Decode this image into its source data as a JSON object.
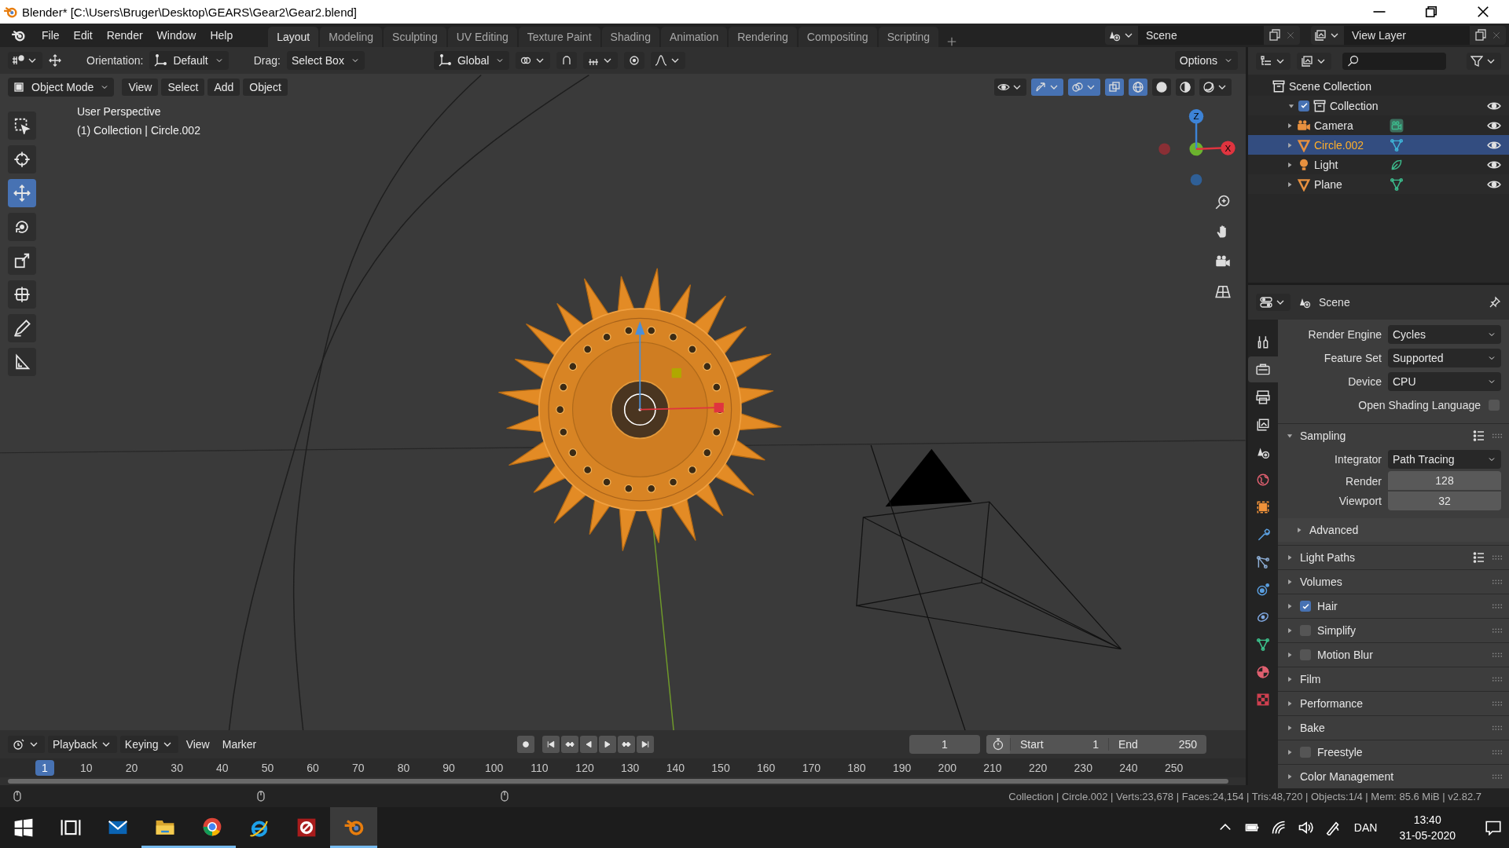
{
  "window": {
    "title": "Blender* [C:\\Users\\Bruger\\Desktop\\GEARS\\Gear2\\Gear2.blend]"
  },
  "menu": [
    "File",
    "Edit",
    "Render",
    "Window",
    "Help"
  ],
  "workspaces": [
    {
      "label": "Layout",
      "selected": true
    },
    {
      "label": "Modeling",
      "selected": false
    },
    {
      "label": "Sculpting",
      "selected": false
    },
    {
      "label": "UV Editing",
      "selected": false
    },
    {
      "label": "Texture Paint",
      "selected": false
    },
    {
      "label": "Shading",
      "selected": false
    },
    {
      "label": "Animation",
      "selected": false
    },
    {
      "label": "Rendering",
      "selected": false
    },
    {
      "label": "Compositing",
      "selected": false
    },
    {
      "label": "Scripting",
      "selected": false
    }
  ],
  "scene": "Scene",
  "view_layer": "View Layer",
  "tool_settings": {
    "orientation_label": "Orientation:",
    "orientation": "Default",
    "drag_label": "Drag:",
    "drag": "Select Box",
    "transform_orientation": "Global",
    "options": "Options"
  },
  "viewport_header": {
    "mode": "Object Mode",
    "menus": [
      "View",
      "Select",
      "Add",
      "Object"
    ]
  },
  "tools": [
    {
      "kind": "select_box",
      "selected": false
    },
    {
      "kind": "cursor",
      "selected": false
    },
    {
      "kind": "move",
      "selected": true
    },
    {
      "kind": "rotate",
      "selected": false
    },
    {
      "kind": "scale",
      "selected": false
    },
    {
      "kind": "transform",
      "selected": false
    },
    {
      "kind": "annotate",
      "selected": false
    },
    {
      "kind": "measure",
      "selected": false
    }
  ],
  "viewport_info": [
    "User Perspective",
    "(1) Collection | Circle.002"
  ],
  "navigation_gizmo": {
    "z": "Z",
    "x": "X"
  },
  "outliner": {
    "root": "Scene Collection",
    "items": [
      {
        "label": "Collection",
        "kind": "collection",
        "expanded": true,
        "checked": true,
        "selected": false,
        "children": [
          {
            "label": "Camera",
            "kind": "camera",
            "expanded": false,
            "selected": false
          },
          {
            "label": "Circle.002",
            "kind": "mesh",
            "expanded": false,
            "selected": true
          },
          {
            "label": "Light",
            "kind": "light",
            "expanded": false,
            "selected": false
          },
          {
            "label": "Plane",
            "kind": "mesh",
            "expanded": false,
            "selected": false
          }
        ]
      }
    ]
  },
  "properties": {
    "context": "Scene",
    "tabs": [
      {
        "kind": "tool",
        "selected": false
      },
      {
        "kind": "render",
        "selected": true
      },
      {
        "kind": "output",
        "selected": false
      },
      {
        "kind": "view_layer",
        "selected": false
      },
      {
        "kind": "scene",
        "selected": false
      },
      {
        "kind": "world",
        "selected": false
      },
      {
        "kind": "object",
        "selected": false
      },
      {
        "kind": "modifiers",
        "selected": false
      },
      {
        "kind": "particles",
        "selected": false
      },
      {
        "kind": "physics",
        "selected": false
      },
      {
        "kind": "constraints",
        "selected": false
      },
      {
        "kind": "data",
        "selected": false
      },
      {
        "kind": "material",
        "selected": false
      },
      {
        "kind": "texture",
        "selected": false
      }
    ],
    "fields": [
      {
        "label": "Render Engine",
        "kind": "dropdown",
        "value": "Cycles"
      },
      {
        "label": "Feature Set",
        "kind": "dropdown",
        "value": "Supported"
      },
      {
        "label": "Device",
        "kind": "dropdown",
        "value": "CPU"
      },
      {
        "label": "Open Shading Language",
        "kind": "checkbox",
        "checked": false
      }
    ],
    "panels": [
      {
        "title": "Sampling",
        "kind": "plain",
        "expanded": true,
        "presets": true,
        "fields": [
          {
            "label": "Integrator",
            "kind": "dropdown",
            "value": "Path Tracing"
          },
          {
            "label": "Render",
            "kind": "number",
            "value": "128"
          },
          {
            "label": "Viewport",
            "kind": "number",
            "value": "32"
          }
        ],
        "subpanels": [
          {
            "title": "Advanced",
            "expanded": false
          }
        ]
      },
      {
        "title": "Light Paths",
        "kind": "plain",
        "expanded": false,
        "presets": true
      },
      {
        "title": "Volumes",
        "kind": "plain",
        "expanded": false,
        "presets": false
      },
      {
        "title": "Hair",
        "kind": "toggle",
        "checked": true,
        "expanded": false,
        "presets": false
      },
      {
        "title": "Simplify",
        "kind": "toggle",
        "checked": false,
        "expanded": false,
        "presets": false
      },
      {
        "title": "Motion Blur",
        "kind": "toggle",
        "checked": false,
        "expanded": false,
        "presets": false
      },
      {
        "title": "Film",
        "kind": "plain",
        "expanded": false,
        "presets": false
      },
      {
        "title": "Performance",
        "kind": "plain",
        "expanded": false,
        "presets": false
      },
      {
        "title": "Bake",
        "kind": "plain",
        "expanded": false,
        "presets": false
      },
      {
        "title": "Freestyle",
        "kind": "toggle",
        "checked": false,
        "expanded": false,
        "presets": false
      },
      {
        "title": "Color Management",
        "kind": "plain",
        "expanded": false,
        "presets": false
      }
    ]
  },
  "timeline": {
    "menus": [
      {
        "label": "Playback",
        "dropdown": true
      },
      {
        "label": "Keying",
        "dropdown": true
      },
      {
        "label": "View",
        "dropdown": false
      },
      {
        "label": "Marker",
        "dropdown": false
      }
    ],
    "current_frame": "1",
    "start": {
      "label": "Start",
      "value": "1"
    },
    "end": {
      "label": "End",
      "value": "250"
    },
    "ruler": {
      "current": "1",
      "ticks": [
        "10",
        "20",
        "30",
        "40",
        "50",
        "60",
        "70",
        "80",
        "90",
        "100",
        "110",
        "120",
        "130",
        "140",
        "150",
        "160",
        "170",
        "180",
        "190",
        "200",
        "210",
        "220",
        "230",
        "240",
        "250"
      ]
    }
  },
  "status_bar": "Collection | Circle.002 | Verts:23,678 | Faces:24,154 | Tris:48,720 | Objects:1/4 | Mem: 85.6 MiB | v2.82.7",
  "taskbar": {
    "apps": [
      {
        "kind": "start",
        "running": false,
        "selected": false
      },
      {
        "kind": "task_view",
        "running": false,
        "selected": false
      },
      {
        "kind": "mail",
        "running": false,
        "selected": false
      },
      {
        "kind": "explorer",
        "running": true,
        "selected": false
      },
      {
        "kind": "chrome",
        "running": true,
        "selected": false
      },
      {
        "kind": "internet_explorer",
        "running": false,
        "selected": false
      },
      {
        "kind": "settings_app",
        "running": false,
        "selected": false
      },
      {
        "kind": "blender",
        "running": true,
        "selected": true
      }
    ],
    "language": "DAN",
    "time": "13:40",
    "date": "31-05-2020"
  }
}
